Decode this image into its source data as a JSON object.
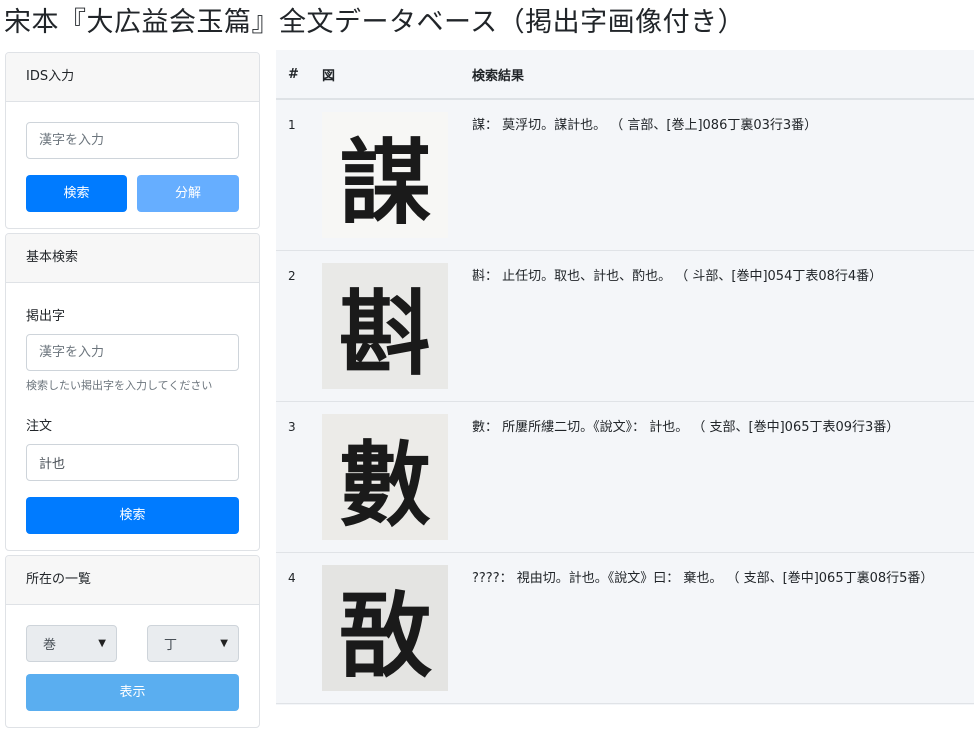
{
  "page_title": "宋本『大広益会玉篇』全文データベース（掲出字画像付き）",
  "ids_panel": {
    "header": "IDS入力",
    "input_placeholder": "漢字を入力",
    "search_label": "検索",
    "decompose_label": "分解"
  },
  "basic_panel": {
    "header": "基本検索",
    "headword_label": "掲出字",
    "headword_placeholder": "漢字を入力",
    "headword_help": "検索したい掲出字を入力してください",
    "annotation_label": "注文",
    "annotation_value": "計也",
    "search_label": "検索"
  },
  "location_panel": {
    "header": "所在の一覧",
    "volume_value": "巻",
    "page_value": "丁",
    "show_label": "表示"
  },
  "results": {
    "headers": {
      "num": "#",
      "image": "図",
      "result": "検索結果"
    },
    "rows": [
      {
        "num": "1",
        "glyph": "謀",
        "text": "謀： 莫浮切。謀計也。 （ 言部、[巻上]086丁裏03行3番）"
      },
      {
        "num": "2",
        "glyph": "斟",
        "text": "斟： 止任切。取也、計也、酌也。 （ 斗部、[巻中]054丁表08行4番）"
      },
      {
        "num": "3",
        "glyph": "數",
        "text": "數： 所屢所縷二切。《說文》： 計也。 （ 支部、[巻中]065丁表09行3番）"
      },
      {
        "num": "4",
        "glyph": "敔",
        "text": "????： 視由切。計也。《說文》曰： 棄也。 （ 支部、[巻中]065丁裏08行5番）"
      }
    ]
  }
}
